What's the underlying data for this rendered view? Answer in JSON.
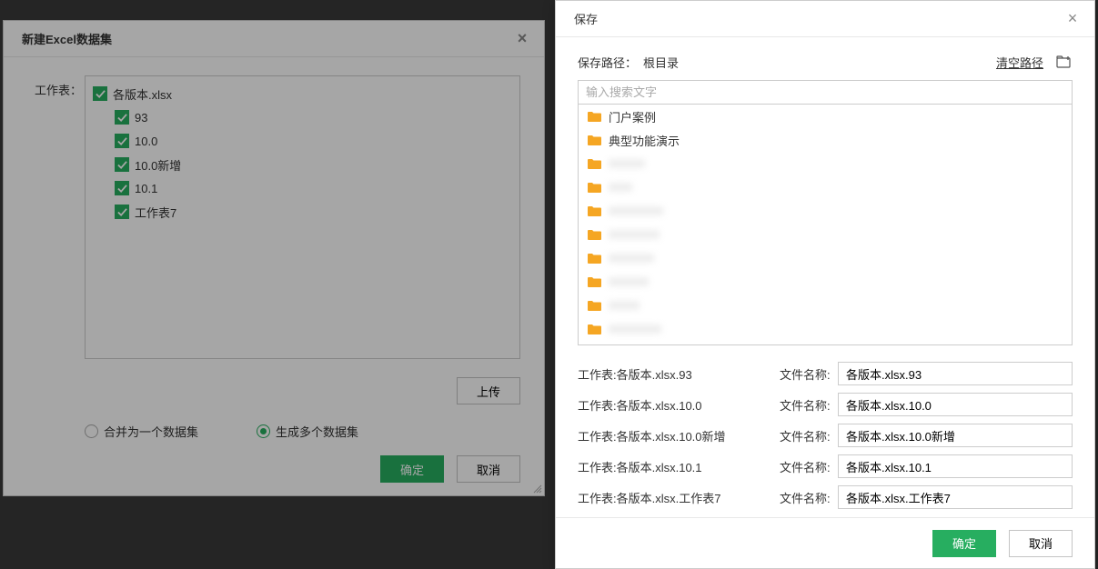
{
  "left": {
    "title": "新建Excel数据集",
    "workbook_label": "工作表：",
    "tree": {
      "root": "各版本.xlsx",
      "children": [
        "93",
        "10.0",
        "10.0新增",
        "10.1",
        "工作表7"
      ]
    },
    "upload_label": "上传",
    "radio_merge": "合并为一个数据集",
    "radio_multi": "生成多个数据集",
    "ok": "确定",
    "cancel": "取消"
  },
  "right": {
    "title": "保存",
    "path_label": "保存路径：",
    "path_value": "根目录",
    "clear_path": "清空路径",
    "search_placeholder": "输入搜索文字",
    "folders_visible": [
      "门户案例",
      "典型功能演示"
    ],
    "name_rows": [
      {
        "sheet": "工作表:各版本.xlsx.93",
        "label": "文件名称:",
        "value": "各版本.xlsx.93"
      },
      {
        "sheet": "工作表:各版本.xlsx.10.0",
        "label": "文件名称:",
        "value": "各版本.xlsx.10.0"
      },
      {
        "sheet": "工作表:各版本.xlsx.10.0新增",
        "label": "文件名称:",
        "value": "各版本.xlsx.10.0新增"
      },
      {
        "sheet": "工作表:各版本.xlsx.10.1",
        "label": "文件名称:",
        "value": "各版本.xlsx.10.1"
      },
      {
        "sheet": "工作表:各版本.xlsx.工作表7",
        "label": "文件名称:",
        "value": "各版本.xlsx.工作表7"
      }
    ],
    "ok": "确定",
    "cancel": "取消"
  }
}
